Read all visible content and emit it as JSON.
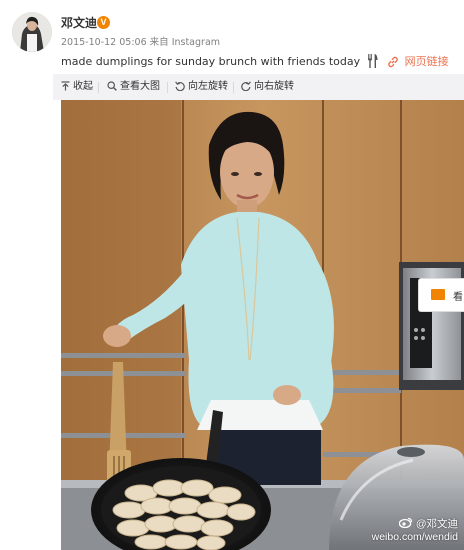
{
  "post": {
    "username": "邓文迪",
    "verified_badge": "V",
    "timestamp": "2015-10-12 05:06",
    "source_label": "来自",
    "source": "Instagram",
    "text": "made dumplings for sunday brunch with friends today",
    "link_label": "网页链接"
  },
  "toolbar": {
    "collapse": "收起",
    "view_large": "查看大图",
    "rotate_left": "向左旋转",
    "rotate_right": "向右旋转"
  },
  "photo": {
    "watermark_handle": "@邓文迪",
    "watermark_url": "weibo.com/wendid"
  },
  "share_tab": {
    "label": "看"
  },
  "colors": {
    "link": "#eb7350",
    "badge": "#f08300",
    "toolbar_bg": "#f2f2f5",
    "meta_text": "#808080"
  },
  "icons": [
    "fork-knife-icon",
    "link-icon",
    "collapse-icon",
    "zoom-icon",
    "rotate-left-icon",
    "rotate-right-icon",
    "mail-icon",
    "weibo-logo-icon"
  ]
}
